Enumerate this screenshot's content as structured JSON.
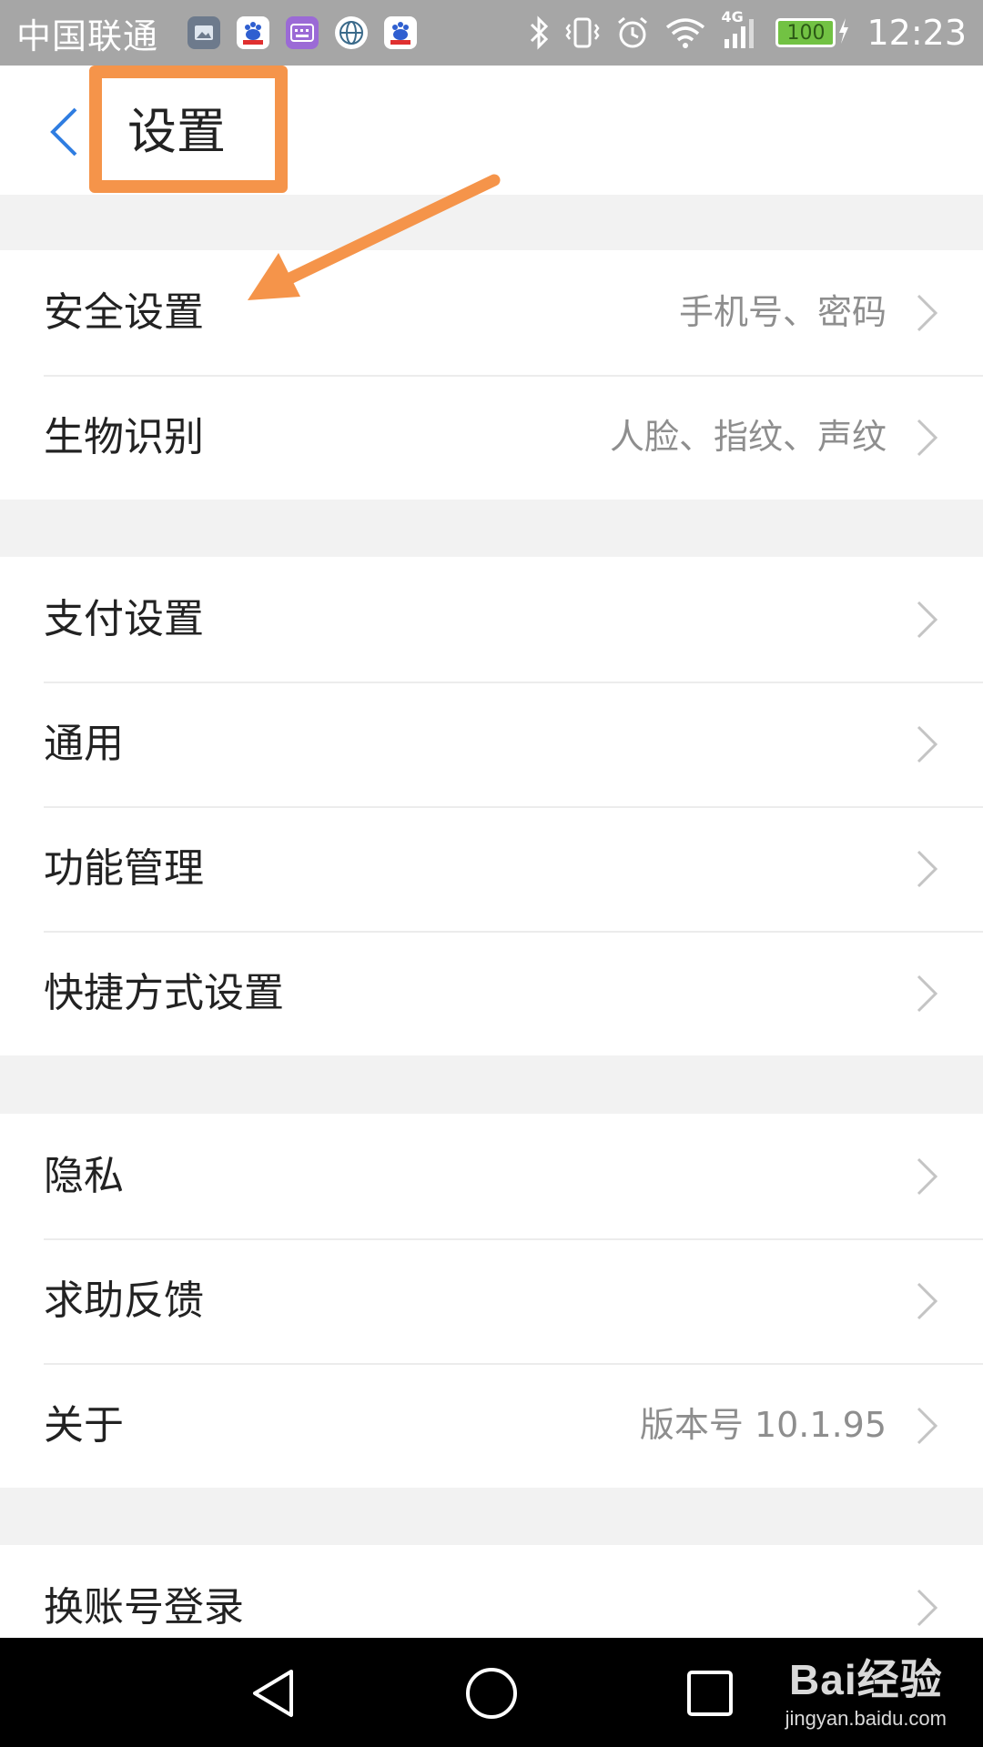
{
  "status_bar": {
    "carrier": "中国联通",
    "time": "12:23",
    "battery": "100",
    "network": "4G",
    "notification_icons": [
      "gallery-icon",
      "baidu-icon",
      "keyboard-icon",
      "globe-icon",
      "baidu-icon"
    ],
    "system_icons": [
      "bluetooth-icon",
      "vibrate-icon",
      "alarm-icon",
      "wifi-icon",
      "signal-icon",
      "battery-icon"
    ]
  },
  "header": {
    "back_icon": "chevron-left-icon",
    "title": "设置"
  },
  "groups": [
    {
      "items": [
        {
          "label": "安全设置",
          "value": "手机号、密码"
        },
        {
          "label": "生物识别",
          "value": "人脸、指纹、声纹"
        }
      ]
    },
    {
      "items": [
        {
          "label": "支付设置",
          "value": ""
        },
        {
          "label": "通用",
          "value": ""
        },
        {
          "label": "功能管理",
          "value": ""
        },
        {
          "label": "快捷方式设置",
          "value": ""
        }
      ]
    },
    {
      "items": [
        {
          "label": "隐私",
          "value": ""
        },
        {
          "label": "求助反馈",
          "value": ""
        },
        {
          "label": "关于",
          "value": "版本号 10.1.95"
        }
      ]
    },
    {
      "items": [
        {
          "label": "换账号登录",
          "value": ""
        }
      ]
    }
  ],
  "annotations": {
    "highlight_color": "#f5944a"
  },
  "nav_bar": {
    "buttons": [
      "back-triangle-icon",
      "home-circle-icon",
      "recents-square-icon"
    ]
  },
  "watermark": {
    "logo": "Bai经验",
    "url": "jingyan.baidu.com"
  },
  "colors": {
    "accent": "#2f7de1",
    "status_bar_bg": "#a6a6a6",
    "page_bg": "#f2f2f2",
    "nav_bg": "#000000",
    "battery_green": "#72c243"
  }
}
